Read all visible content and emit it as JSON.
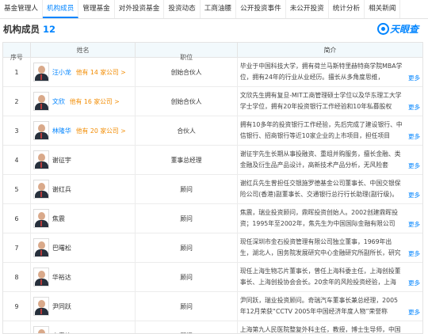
{
  "tabs": [
    {
      "label": "基金管理人",
      "active": false
    },
    {
      "label": "机构成员",
      "active": true
    },
    {
      "label": "管理基金",
      "active": false
    },
    {
      "label": "对外投资基金",
      "active": false
    },
    {
      "label": "投资动态",
      "active": false
    },
    {
      "label": "工商油腰",
      "active": false
    },
    {
      "label": "公开投资事件",
      "active": false
    },
    {
      "label": "未公开投资",
      "active": false
    },
    {
      "label": "统计分析",
      "active": false
    },
    {
      "label": "相关新闻",
      "active": false
    }
  ],
  "section": {
    "title": "机构成员",
    "count": "12"
  },
  "brand": {
    "name": "天眼查"
  },
  "table": {
    "headers": {
      "no": "序号",
      "name": "姓名",
      "position": "职位",
      "bio": "简介"
    },
    "more_label": "更多",
    "rows": [
      {
        "no": "1",
        "name": "汪小龙",
        "link": true,
        "note": "他有 14 家公司 >",
        "position": "创始合伙人",
        "bio": "毕业于中国科技大学，拥有荷兰马斯特里赫特商学院MBA学位，拥有24年的行业从业经历。擅长从多角度思维，"
      },
      {
        "no": "2",
        "name": "文欣",
        "link": true,
        "note": "他有 16 家公司 >",
        "position": "创始合伙人",
        "bio": "文欣先生拥有复旦-MIT工商管理硕士学位以及华东理工大学学士学位，拥有20年投资银行工作经验和10年私募股权"
      },
      {
        "no": "3",
        "name": "林隆华",
        "link": true,
        "note": "他有 20 家公司 >",
        "position": "合伙人",
        "bio": "拥有10多年的投资银行工作经验，先后完成了建设银行、中信银行、招商银行等近10家企业的上市项目，担任项目"
      },
      {
        "no": "4",
        "name": "谢征宇",
        "link": false,
        "note": "",
        "position": "董事总经理",
        "bio": "谢征宇先生长期从事投融资、重组并购服务，擅长金融、类金融及衍生品产品设计，高新技术产品分析，无风险套"
      },
      {
        "no": "5",
        "name": "谢红兵",
        "link": false,
        "note": "",
        "position": "顾问",
        "bio": "谢红兵先生曾担任交银施罗德基金公司董事长、中国交银保险公司(香港)副董事长、交通银行总行行长助理(副行级)。"
      },
      {
        "no": "6",
        "name": "焦震",
        "link": false,
        "note": "",
        "position": "顾问",
        "bio": "焦震，瑞业投资顾问，鼎晖投资创始人。2002创建鼎晖投资；1995年至2002年，焦先生为中国国际金融有限公司"
      },
      {
        "no": "7",
        "name": "巴曙松",
        "link": false,
        "note": "",
        "position": "顾问",
        "bio": "现任深圳市金石投资管理有限公司独立董事，1969年出生，湖北人，国务院发展研究中心金融研究所副所长，研究"
      },
      {
        "no": "8",
        "name": "华裕达",
        "link": false,
        "note": "",
        "position": "顾问",
        "bio": "现任上海生物芯片董事长，曾任上海科委主任，上海创投董事长、上海创投协会会长。20余年的风险投资经验，上海"
      },
      {
        "no": "9",
        "name": "尹同跃",
        "link": false,
        "note": "",
        "position": "顾问",
        "bio": "尹同跃，瑞业投资顾问。奇瑞汽车董事长兼总经理，2005年12月荣获“CCTV 2005年中国经济年度人物”荣誉称"
      },
      {
        "no": "10",
        "name": "李青峰",
        "link": false,
        "note": "",
        "position": "顾问",
        "bio": "上海第九人民医院整复外科主任，教授，博士生导师，中国医师协会美容与整形医师分会会长，上海多个国内外"
      }
    ]
  }
}
